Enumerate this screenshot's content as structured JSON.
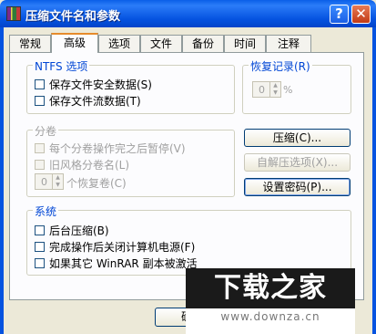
{
  "window": {
    "title": "压缩文件名和参数",
    "help_label": "?",
    "close_label": "✕"
  },
  "tabs": [
    {
      "label": "常规"
    },
    {
      "label": "高级"
    },
    {
      "label": "选项"
    },
    {
      "label": "文件"
    },
    {
      "label": "备份"
    },
    {
      "label": "时间"
    },
    {
      "label": "注释"
    }
  ],
  "ntfs": {
    "title": "NTFS 选项",
    "items": [
      {
        "label": "保存文件安全数据(S)"
      },
      {
        "label": "保存文件流数据(T)"
      }
    ]
  },
  "recovery": {
    "title": "恢复记录(R)",
    "value": "0",
    "unit": "%"
  },
  "volume": {
    "title": "分卷",
    "items": [
      {
        "label": "每个分卷操作完之后暂停(V)"
      },
      {
        "label": "旧风格分卷名(L)"
      }
    ],
    "recovery_value": "0",
    "recovery_label": "个恢复卷(C)"
  },
  "buttons": {
    "compress": "压缩(C)...",
    "sfx": "自解压选项(X)...",
    "password": "设置密码(P)..."
  },
  "system": {
    "title": "系统",
    "items": [
      {
        "label": "后台压缩(B)"
      },
      {
        "label": "完成操作后关闭计算机电源(F)"
      },
      {
        "label": "如果其它 WinRAR 副本被激活"
      }
    ]
  },
  "ok_label": "确",
  "watermark": {
    "main": "下载之家",
    "url": "www.downza.cn"
  }
}
